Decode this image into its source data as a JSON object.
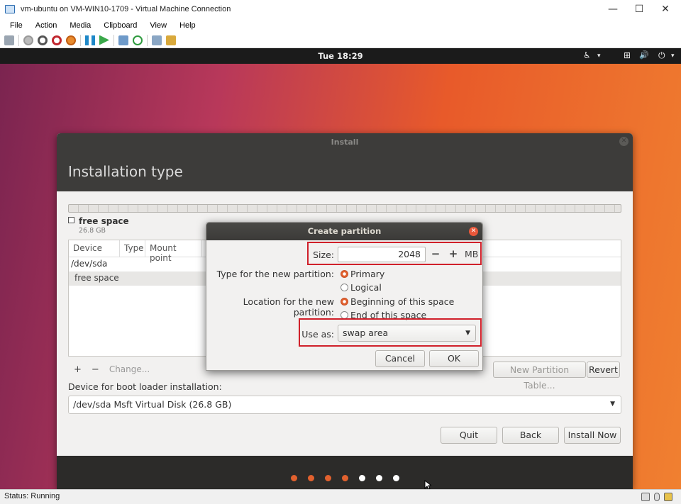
{
  "window": {
    "title": "vm-ubuntu on VM-WIN10-1709 - Virtual Machine Connection",
    "minimize_glyph": "—",
    "maximize_glyph": "☐",
    "close_glyph": "✕"
  },
  "menu": [
    "File",
    "Action",
    "Media",
    "Clipboard",
    "View",
    "Help"
  ],
  "toolbar_icons": [
    "ctrl-alt-del-icon",
    "start-icon",
    "turn-off-icon",
    "shutdown-icon",
    "save-icon",
    "pause-icon",
    "reset-icon",
    "checkpoint-icon",
    "revert-icon",
    "enhanced-session-icon",
    "share-icon"
  ],
  "top_panel": {
    "clock": "Tue 18:29",
    "accessibility_glyph": "♿",
    "network_glyph": "⊞",
    "volume_glyph": "🔊",
    "power_glyph": "⏻",
    "dropdown_glyph": "▾"
  },
  "installer": {
    "window_title": "Install",
    "page_title": "Installation type",
    "free_space_label": "free space",
    "free_space_size": "26.8 GB",
    "columns": [
      "Device",
      "Type",
      "Mount point"
    ],
    "rows": [
      "/dev/sda",
      "free space"
    ],
    "add_glyph": "+",
    "remove_glyph": "−",
    "change_label": "Change...",
    "new_partition_table_label": "New Partition Table...",
    "revert_label": "Revert",
    "boot_loader_label": "Device for boot loader installation:",
    "boot_loader_value": "/dev/sda Msft Virtual Disk (26.8 GB)",
    "quit_label": "Quit",
    "back_label": "Back",
    "install_now_label": "Install Now",
    "progress_dots": {
      "done": 4,
      "total": 7
    }
  },
  "dialog": {
    "title": "Create partition",
    "size_label": "Size:",
    "size_value": "2048",
    "size_minus": "−",
    "size_plus": "+",
    "size_unit": "MB",
    "type_label": "Type for the new partition:",
    "type_primary": "Primary",
    "type_logical": "Logical",
    "location_label": "Location for the new partition:",
    "location_beginning": "Beginning of this space",
    "location_end": "End of this space",
    "use_as_label": "Use as:",
    "use_as_value": "swap area",
    "cancel_label": "Cancel",
    "ok_label": "OK"
  },
  "status": {
    "text": "Status: Running"
  },
  "colors": {
    "accent": "#e2612e",
    "highlight": "#d0202a",
    "dot_done": "#e2612e",
    "dot_todo": "#ffffff"
  }
}
